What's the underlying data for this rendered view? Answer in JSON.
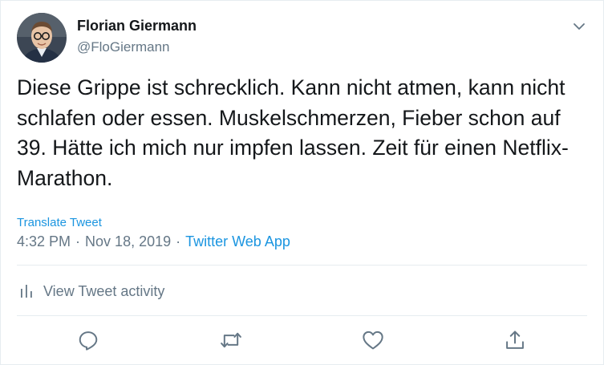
{
  "tweet": {
    "author": {
      "name": "Florian Giermann",
      "handle": "@FloGiermann"
    },
    "text": "Diese Grippe ist schrecklich. Kann nicht atmen, kann nicht schlafen oder essen. Muskelschmerzen, Fieber schon auf 39. Hätte ich mich nur impfen lassen. Zeit für einen Netflix-Marathon.",
    "translate_label": "Translate Tweet",
    "time": "4:32 PM",
    "separator": "·",
    "date": "Nov 18, 2019",
    "source": "Twitter Web App",
    "activity_label": "View Tweet activity"
  },
  "icons": {
    "menu": "chevron-down-icon",
    "activity": "bar-chart-icon",
    "reply": "reply-icon",
    "retweet": "retweet-icon",
    "like": "heart-icon",
    "share": "share-icon"
  },
  "colors": {
    "text": "#14171a",
    "secondary": "#657786",
    "link": "#1b95e0",
    "border": "#e6ecf0"
  }
}
